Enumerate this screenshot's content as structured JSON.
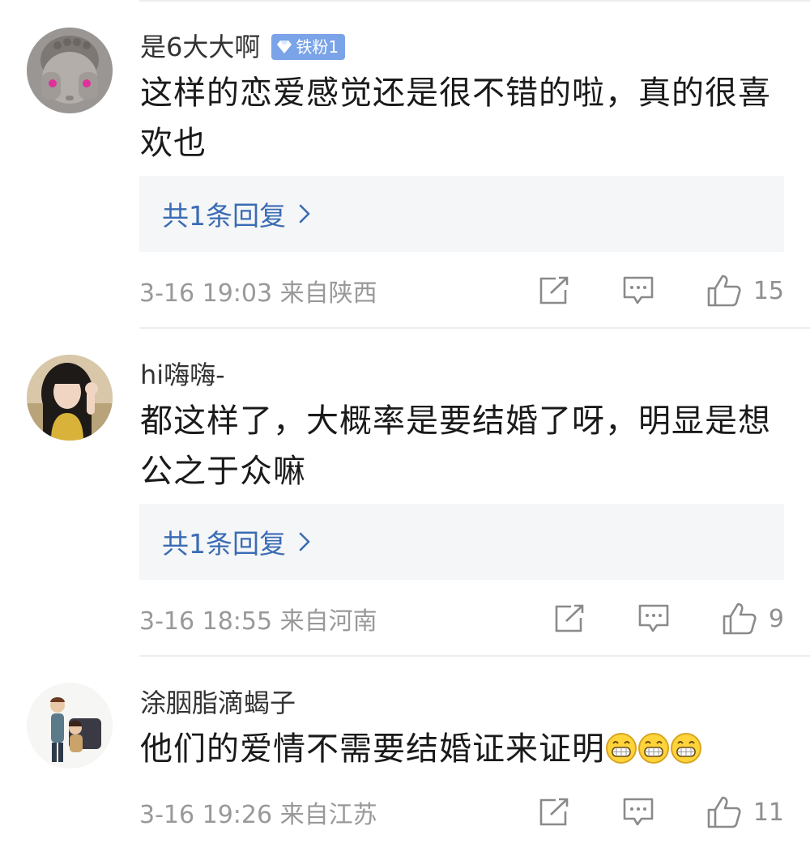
{
  "comments": [
    {
      "username": "是6大大啊",
      "badge": "铁粉1",
      "text": "这样的恋爱感觉还是很不错的啦，真的很喜欢也",
      "reply_label": "共1条回复",
      "meta": "3-16 19:03  来自陕西",
      "likes": "15"
    },
    {
      "username": "hi嗨嗨-",
      "text": "都这样了，大概率是要结婚了呀，明显是想公之于众嘛",
      "reply_label": "共1条回复",
      "meta": "3-16 18:55  来自河南",
      "likes": "9"
    },
    {
      "username": "涂胭脂滴蝎子",
      "text": "他们的爱情不需要结婚证来证明",
      "emoji": "grinning-face-emoji",
      "emoji_count": 3,
      "meta": "3-16 19:26  来自江苏",
      "likes": "11"
    }
  ],
  "icons": {
    "share": "share-icon",
    "comment": "comment-icon",
    "like": "thumbs-up-icon"
  },
  "colors": {
    "link": "#3b6cb3",
    "badge": "#7aa3e8",
    "meta": "#999999",
    "reply_bg": "#f5f6f8"
  }
}
